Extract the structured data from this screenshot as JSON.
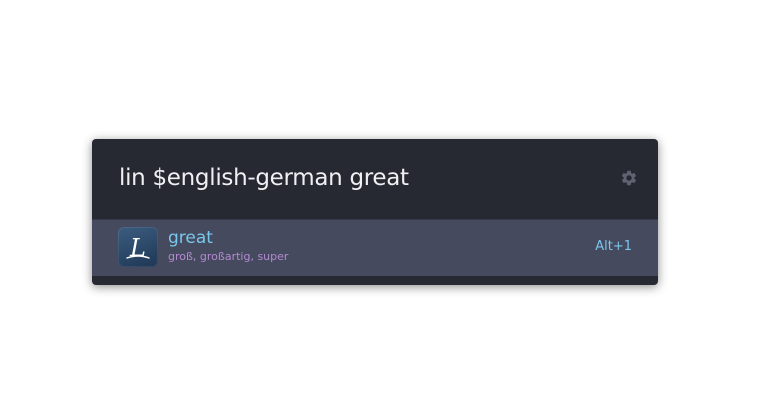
{
  "launcher": {
    "query_value": "lin $english-german great",
    "settings_icon": "gear-icon"
  },
  "results": [
    {
      "icon": "dictionary-app-icon",
      "icon_letter": "L",
      "title": "great",
      "description": "groß, großartig, super",
      "shortcut": "Alt+1"
    }
  ],
  "colors": {
    "window_bg": "#262832",
    "selected_row_bg": "#464a5e",
    "title": "#79c7ec",
    "description": "#b48ad2",
    "query_text": "#f0f0f2"
  }
}
